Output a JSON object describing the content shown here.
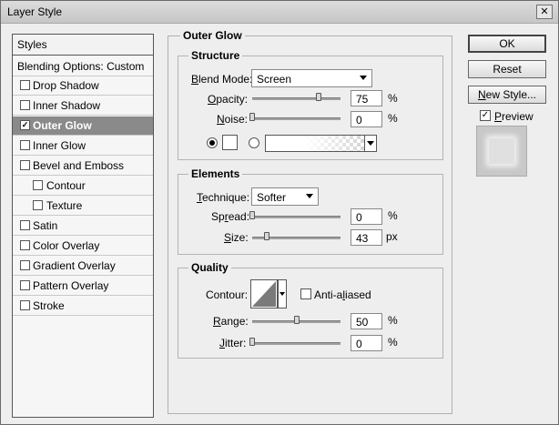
{
  "window": {
    "title": "Layer Style",
    "close_glyph": "✕"
  },
  "styles_panel": {
    "header": "Styles",
    "blending_options": "Blending Options: Custom",
    "items": [
      {
        "label": "Drop Shadow",
        "checked": false,
        "selected": false,
        "indent": false
      },
      {
        "label": "Inner Shadow",
        "checked": false,
        "selected": false,
        "indent": false
      },
      {
        "label": "Outer Glow",
        "checked": true,
        "selected": true,
        "indent": false
      },
      {
        "label": "Inner Glow",
        "checked": false,
        "selected": false,
        "indent": false
      },
      {
        "label": "Bevel and Emboss",
        "checked": false,
        "selected": false,
        "indent": false
      },
      {
        "label": "Contour",
        "checked": false,
        "selected": false,
        "indent": true
      },
      {
        "label": "Texture",
        "checked": false,
        "selected": false,
        "indent": true
      },
      {
        "label": "Satin",
        "checked": false,
        "selected": false,
        "indent": false
      },
      {
        "label": "Color Overlay",
        "checked": false,
        "selected": false,
        "indent": false
      },
      {
        "label": "Gradient Overlay",
        "checked": false,
        "selected": false,
        "indent": false
      },
      {
        "label": "Pattern Overlay",
        "checked": false,
        "selected": false,
        "indent": false
      },
      {
        "label": "Stroke",
        "checked": false,
        "selected": false,
        "indent": false
      }
    ]
  },
  "outer_glow": {
    "title": "Outer Glow",
    "structure": {
      "title": "Structure",
      "blend_mode_label_u": "B",
      "blend_mode_label_rest": "lend Mode:",
      "blend_mode_value": "Screen",
      "opacity_label_u": "O",
      "opacity_label_rest": "pacity:",
      "opacity_value": "75",
      "opacity_level": 0.75,
      "opacity_unit": "%",
      "noise_label_u": "N",
      "noise_label_rest": "oise:",
      "noise_value": "0",
      "noise_level": 0,
      "noise_unit": "%",
      "color_mode": "solid"
    },
    "elements": {
      "title": "Elements",
      "technique_label_u": "T",
      "technique_label_rest": "echnique:",
      "technique_value": "Softer",
      "spread_label_pre": "Sp",
      "spread_label_u": "r",
      "spread_label_rest": "ead:",
      "spread_value": "0",
      "spread_level": 0,
      "spread_unit": "%",
      "size_label_u": "S",
      "size_label_rest": "ize:",
      "size_value": "43",
      "size_level": 0.17,
      "size_unit": "px"
    },
    "quality": {
      "title": "Quality",
      "contour_label": "Contour:",
      "anti_aliased_pre": "Anti-a",
      "anti_aliased_u": "l",
      "anti_aliased_rest": "iased",
      "anti_aliased_checked": false,
      "range_label_u": "R",
      "range_label_rest": "ange:",
      "range_value": "50",
      "range_level": 0.5,
      "range_unit": "%",
      "jitter_label_u": "J",
      "jitter_label_rest": "itter:",
      "jitter_value": "0",
      "jitter_level": 0,
      "jitter_unit": "%"
    }
  },
  "actions": {
    "ok": "OK",
    "reset": "Reset",
    "new_style_u": "N",
    "new_style_rest": "ew Style...",
    "preview_label_u": "P",
    "preview_label_rest": "review",
    "preview_checked": true
  },
  "icons": {
    "close": "close-icon",
    "dropdown": "chevron-down-icon",
    "check": "checkmark-icon"
  }
}
